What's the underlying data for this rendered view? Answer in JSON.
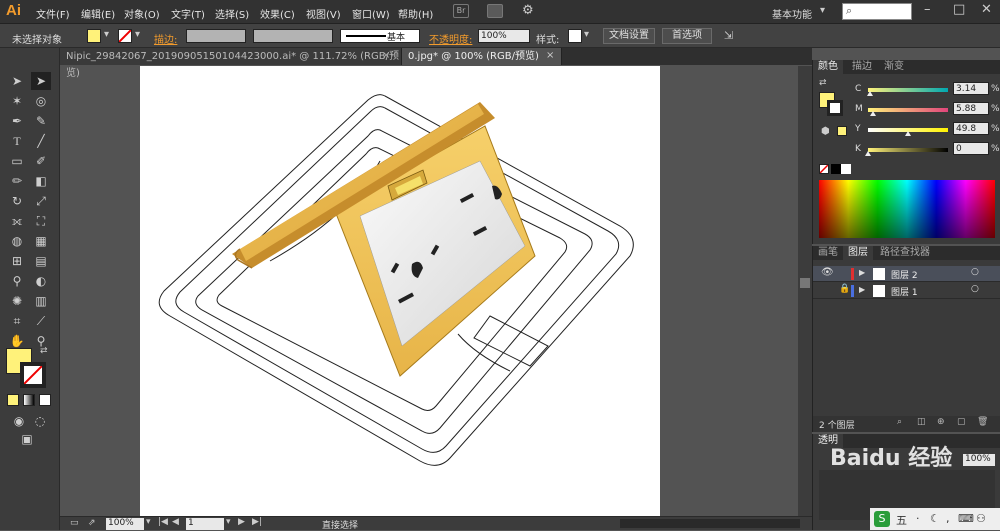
{
  "app": {
    "logo": "Ai",
    "workspace": "基本功能"
  },
  "menu": [
    "文件(F)",
    "编辑(E)",
    "对象(O)",
    "文字(T)",
    "选择(S)",
    "效果(C)",
    "视图(V)",
    "窗口(W)",
    "帮助(H)"
  ],
  "menubar_icons": {
    "bridge": "Br"
  },
  "control_bar": {
    "selection": "未选择对象",
    "stroke_label": "描边:",
    "stroke_style": "基本",
    "opacity_label": "不透明度:",
    "opacity_value": "100%",
    "style_label": "样式:",
    "doc_setup": "文档设置",
    "preferences": "首选项"
  },
  "tabs": [
    {
      "label": "Nipic_29842067_20190905150104423000.ai* @ 111.72% (RGB/预览)",
      "active": false
    },
    {
      "label": "0.jpg* @ 100% (RGB/预览)",
      "active": true
    }
  ],
  "status": {
    "zoom": "100%",
    "page": "1",
    "tool": "直接选择"
  },
  "color_panel": {
    "tabs": [
      "颜色",
      "描边",
      "渐变"
    ],
    "channels": [
      {
        "label": "C",
        "value": "3.14",
        "unit": "%",
        "fraction": 0.03
      },
      {
        "label": "M",
        "value": "5.88",
        "unit": "%",
        "fraction": 0.06
      },
      {
        "label": "Y",
        "value": "49.8",
        "unit": "%",
        "fraction": 0.5
      },
      {
        "label": "K",
        "value": "0",
        "unit": "%",
        "fraction": 0.0
      }
    ]
  },
  "layers_panel": {
    "tabs": [
      "画笔",
      "图层",
      "路径查找器"
    ],
    "layers": [
      {
        "name": "图层 2"
      },
      {
        "name": "图层 1"
      }
    ],
    "count": "2 个图层"
  },
  "transparency_panel": {
    "title": "透明",
    "opacity": "100%"
  },
  "watermark": "Baidu 经验",
  "colors": {
    "fill": "#fff27a",
    "gold": "#e8b84a",
    "accent": "#f29b2c"
  }
}
